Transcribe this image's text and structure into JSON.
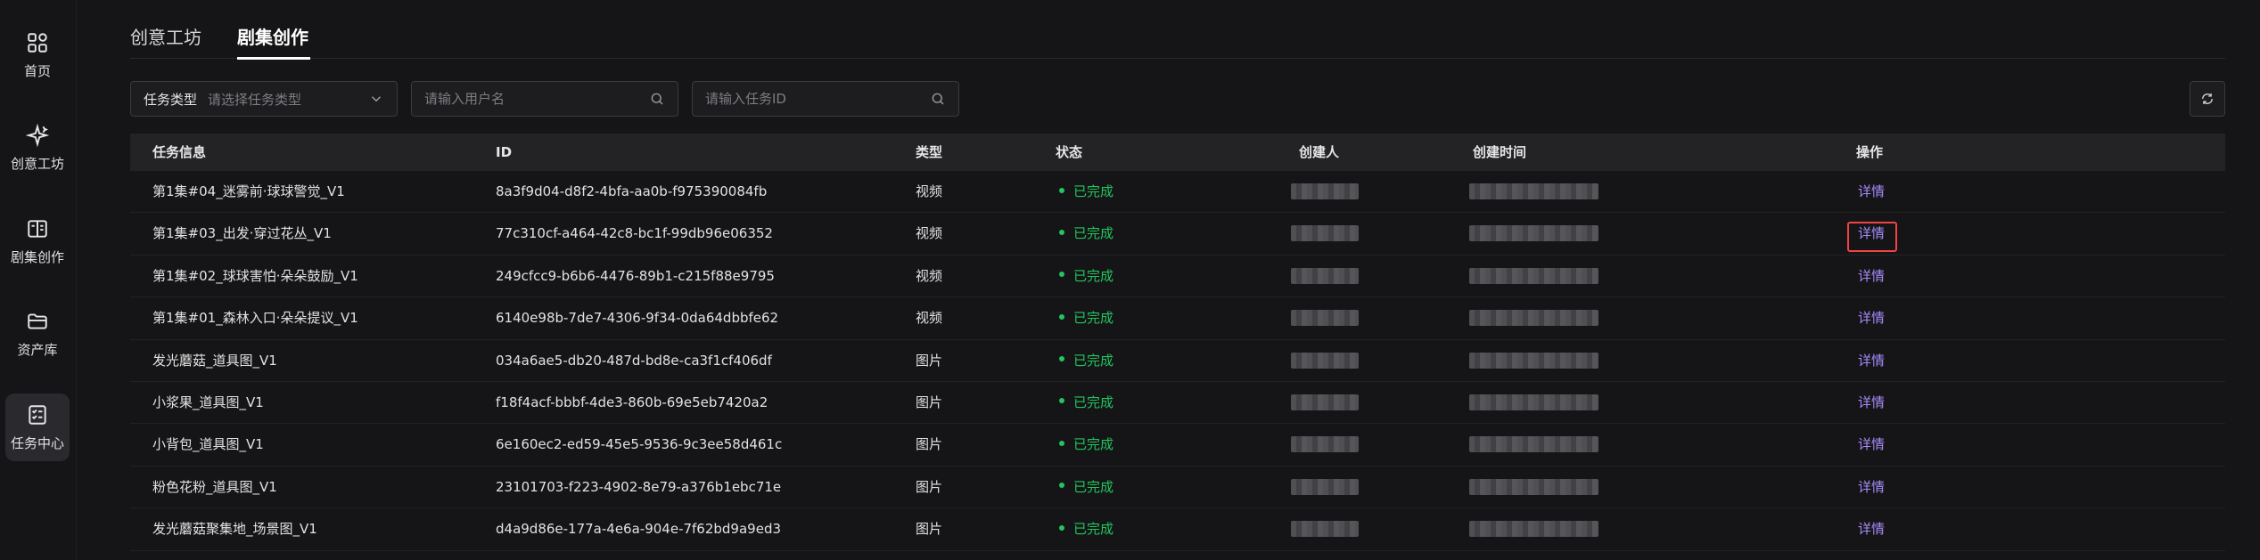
{
  "sidebar": {
    "items": [
      {
        "label": "首页",
        "icon": "grid-icon"
      },
      {
        "label": "创意工坊",
        "icon": "sparkle-icon"
      },
      {
        "label": "剧集创作",
        "icon": "book-icon"
      },
      {
        "label": "资产库",
        "icon": "folder-icon"
      },
      {
        "label": "任务中心",
        "icon": "checklist-icon"
      }
    ],
    "active_index": 4
  },
  "tabs": [
    {
      "label": "创意工坊"
    },
    {
      "label": "剧集创作"
    }
  ],
  "active_tab": 1,
  "filters": {
    "task_type": {
      "label": "任务类型",
      "placeholder": "请选择任务类型"
    },
    "user": {
      "placeholder": "请输入用户名"
    },
    "task_id": {
      "placeholder": "请输入任务ID"
    }
  },
  "table": {
    "columns": [
      "任务信息",
      "ID",
      "类型",
      "状态",
      "创建人",
      "创建时间",
      "操作"
    ],
    "rows": [
      {
        "name": "第1集#04_迷雾前·球球警觉_V1",
        "id": "8a3f9d04-d8f2-4bfa-aa0b-f975390084fb",
        "type": "视频",
        "status": "已完成",
        "action": "详情"
      },
      {
        "name": "第1集#03_出发·穿过花丛_V1",
        "id": "77c310cf-a464-42c8-bc1f-99db96e06352",
        "type": "视频",
        "status": "已完成",
        "action": "详情"
      },
      {
        "name": "第1集#02_球球害怕·朵朵鼓励_V1",
        "id": "249cfcc9-b6b6-4476-89b1-c215f88e9795",
        "type": "视频",
        "status": "已完成",
        "action": "详情"
      },
      {
        "name": "第1集#01_森林入口·朵朵提议_V1",
        "id": "6140e98b-7de7-4306-9f34-0da64dbbfe62",
        "type": "视频",
        "status": "已完成",
        "action": "详情"
      },
      {
        "name": "发光蘑菇_道具图_V1",
        "id": "034a6ae5-db20-487d-bd8e-ca3f1cf406df",
        "type": "图片",
        "status": "已完成",
        "action": "详情"
      },
      {
        "name": "小浆果_道具图_V1",
        "id": "f18f4acf-bbbf-4de3-860b-69e5eb7420a2",
        "type": "图片",
        "status": "已完成",
        "action": "详情"
      },
      {
        "name": "小背包_道具图_V1",
        "id": "6e160ec2-ed59-45e5-9536-9c3ee58d461c",
        "type": "图片",
        "status": "已完成",
        "action": "详情"
      },
      {
        "name": "粉色花粉_道具图_V1",
        "id": "23101703-f223-4902-8e79-a376b1ebc71e",
        "type": "图片",
        "status": "已完成",
        "action": "详情"
      },
      {
        "name": "发光蘑菇聚集地_场景图_V1",
        "id": "d4a9d86e-177a-4e6a-904e-7f62bd9a9ed3",
        "type": "图片",
        "status": "已完成",
        "action": "详情"
      }
    ]
  },
  "colors": {
    "background": "#151517",
    "status_done": "#22c55e",
    "link": "#a78bfa",
    "highlight": "#ef4444"
  }
}
